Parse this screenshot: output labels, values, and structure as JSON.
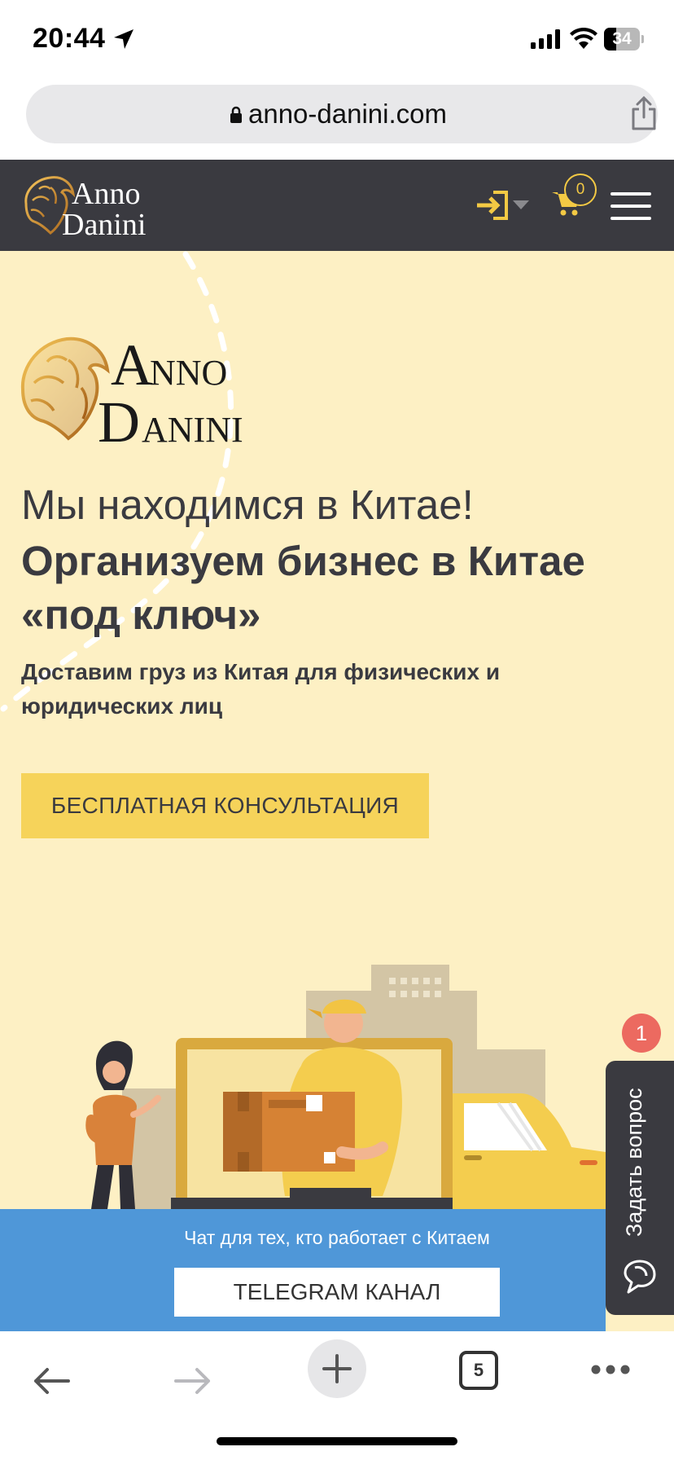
{
  "status_bar": {
    "time": "20:44",
    "battery_percent": "34",
    "battery_level": 0.34
  },
  "browser": {
    "url": "anno-danini.com",
    "open_tabs": "5"
  },
  "header": {
    "logo_text": [
      "Anno",
      "Danini"
    ],
    "cart_count": "0"
  },
  "hero": {
    "subtitle": "Мы находимся в Китае!",
    "title_line1": "Организуем бизнес в Китае",
    "title_line2": "«под ключ»",
    "description": "Доставим груз из Китая для физических и юридических лиц",
    "cta_label": "БЕСПЛАТНАЯ КОНСУЛЬТАЦИЯ"
  },
  "chat_widget": {
    "label": "Задать вопрос",
    "badge": "1"
  },
  "telegram": {
    "text": "Чат для тех, кто работает с Китаем",
    "button_label": "TELEGRAM КАНАЛ"
  },
  "colors": {
    "header_bg": "#3a3a40",
    "accent_yellow": "#f6d35a",
    "hero_bg": "#fdf0c4",
    "telegram_blue": "#4f97d8",
    "badge_red": "#ec6a60"
  },
  "icons": [
    "location-arrow-icon",
    "signal-icon",
    "wifi-icon",
    "battery-icon",
    "lock-icon",
    "share-icon",
    "login-icon",
    "cart-icon",
    "menu-icon",
    "chat-bubble-icon",
    "back-arrow-icon",
    "forward-arrow-icon",
    "plus-icon",
    "more-icon"
  ]
}
